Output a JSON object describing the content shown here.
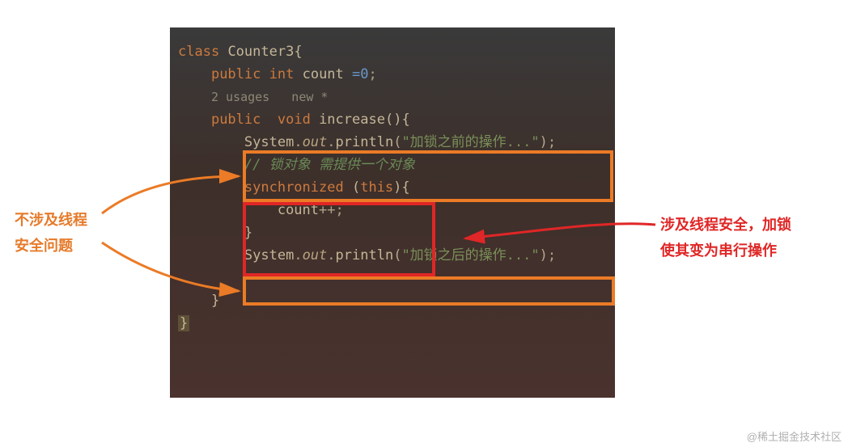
{
  "code": {
    "class_kw": "class",
    "class_name": "Counter3",
    "brace_open": "{",
    "public_kw": "public",
    "int_kw": "int",
    "field_name": "count",
    "equals_zero": " =0",
    "semi": ";",
    "usage_line": "2 usages   new *",
    "void_kw": "void",
    "method_name": "increase",
    "parens": "()",
    "method_brace": "{",
    "system": "System",
    "dot": ".",
    "out": "out",
    "println": "println",
    "str_before": "\"加锁之前的操作...\"",
    "comment_line": "// 锁对象 需提供一个对象",
    "sync_kw": "synchronized",
    "open_paren": " (",
    "this_kw": "this",
    "close_paren_brace": "){",
    "inc_stmt": "count",
    "inc_op": "++",
    "brace_close": "}",
    "str_after": "\"加锁之后的操作...\"",
    "final_brace": "}"
  },
  "annotations": {
    "left_line1": "不涉及线程",
    "left_line2": "安全问题",
    "right_line1": "涉及线程安全，加锁",
    "right_line2": "使其变为串行操作"
  },
  "watermark": "@稀土掘金技术社区"
}
